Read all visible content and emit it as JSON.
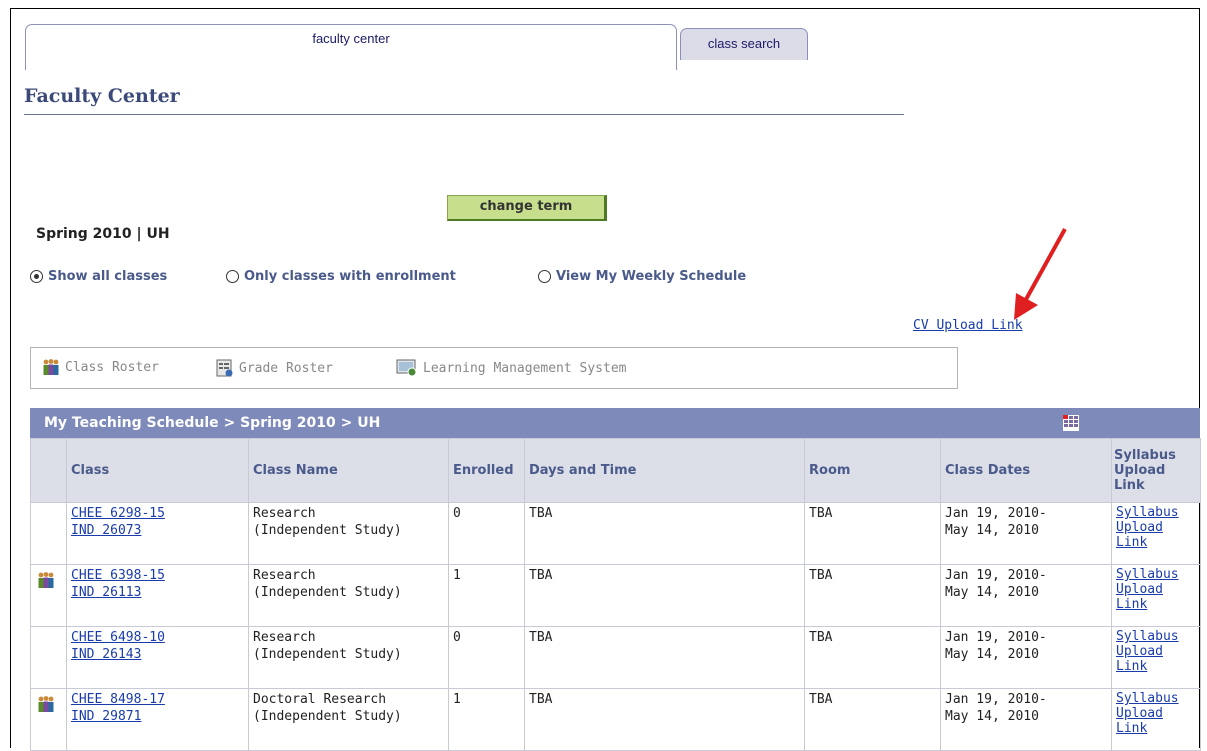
{
  "tabs": {
    "faculty_center": "faculty center",
    "class_search": "class search"
  },
  "page_title": "Faculty Center",
  "term": {
    "label": "Spring 2010 | UH",
    "change_button": "change term"
  },
  "radios": [
    {
      "label": "Show all classes",
      "selected": true
    },
    {
      "label": "Only classes with enrollment",
      "selected": false
    },
    {
      "label": "View My Weekly Schedule",
      "selected": false
    }
  ],
  "cv_link": "CV Upload Link",
  "toolbar": {
    "class_roster": "Class Roster",
    "grade_roster": "Grade Roster",
    "lms": "Learning Management System"
  },
  "grid": {
    "title": "My Teaching Schedule > Spring 2010 > UH",
    "columns": [
      "Class",
      "Class Name",
      "Enrolled",
      "Days and Time",
      "Room",
      "Class Dates",
      "Syllabus Upload Link"
    ],
    "rows": [
      {
        "class_line1": "CHEE 6298-15",
        "class_line2": "IND 26073",
        "name_line1": "Research",
        "name_line2": "(Independent Study)",
        "enrolled": "0",
        "days": "TBA",
        "room": "TBA",
        "dates_line1": "Jan 19, 2010-",
        "dates_line2": "May 14, 2010",
        "syl1": "Syllabus",
        "syl2": "Upload",
        "syl3": "Link",
        "roster_icon": false
      },
      {
        "class_line1": "CHEE 6398-15",
        "class_line2": "IND 26113",
        "name_line1": "Research",
        "name_line2": "(Independent Study)",
        "enrolled": "1",
        "days": "TBA",
        "room": "TBA",
        "dates_line1": "Jan 19, 2010-",
        "dates_line2": "May 14, 2010",
        "syl1": "Syllabus",
        "syl2": "Upload",
        "syl3": "Link",
        "roster_icon": true
      },
      {
        "class_line1": "CHEE 6498-10",
        "class_line2": "IND 26143",
        "name_line1": "Research",
        "name_line2": "(Independent Study)",
        "enrolled": "0",
        "days": "TBA",
        "room": "TBA",
        "dates_line1": "Jan 19, 2010-",
        "dates_line2": "May 14, 2010",
        "syl1": "Syllabus",
        "syl2": "Upload",
        "syl3": "Link",
        "roster_icon": false
      },
      {
        "class_line1": "CHEE 8498-17",
        "class_line2": "IND 29871",
        "name_line1": "Doctoral Research",
        "name_line2": "(Independent Study)",
        "enrolled": "1",
        "days": "TBA",
        "room": "TBA",
        "dates_line1": "Jan 19, 2010-",
        "dates_line2": "May 14, 2010",
        "syl1": "Syllabus",
        "syl2": "Upload",
        "syl3": "Link",
        "roster_icon": true
      }
    ]
  },
  "colors": {
    "header_bg": "#7e8ab9",
    "button_bg": "#c7df8c",
    "link": "#1a3cab",
    "arrow": "#e02020"
  }
}
